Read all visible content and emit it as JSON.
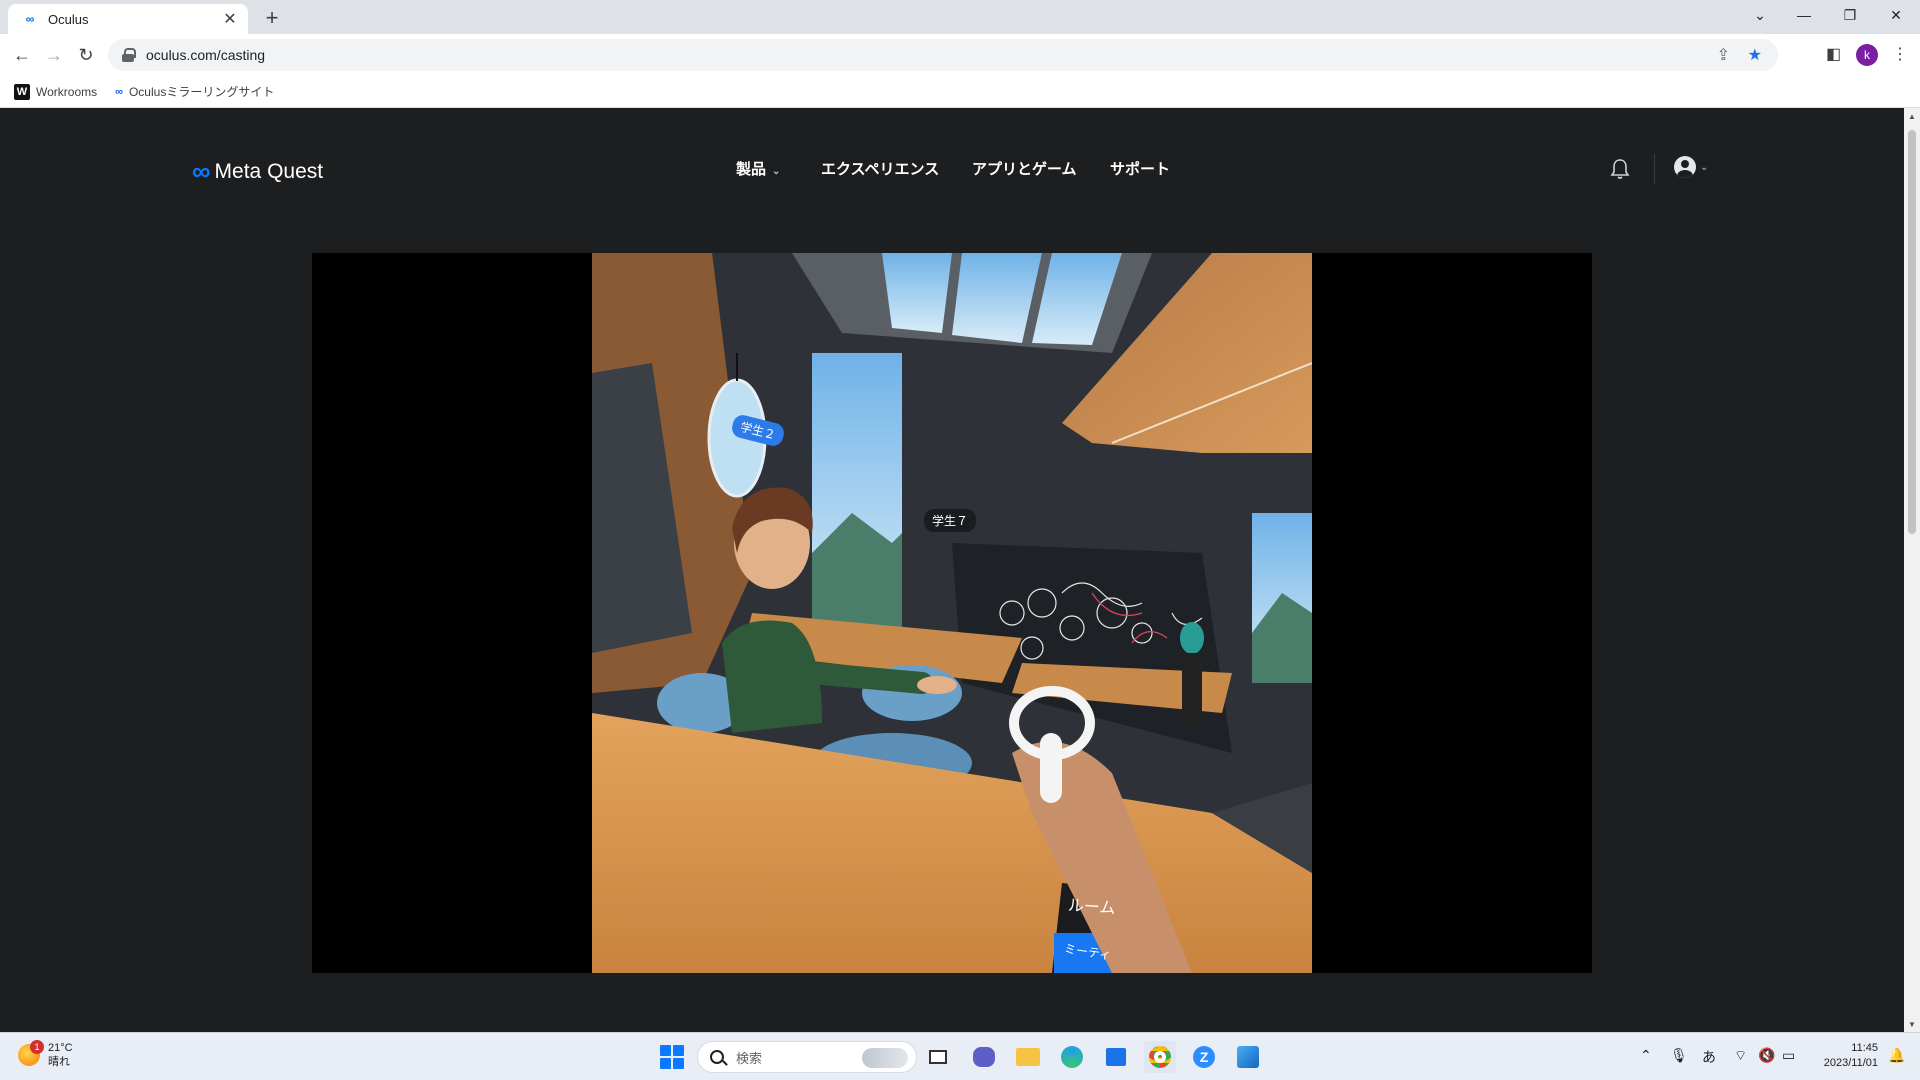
{
  "browser": {
    "tab_title": "Oculus",
    "tab_favicon": "meta-infinity-icon",
    "new_tab_label": "+",
    "url": "oculus.com/casting",
    "bookmarks": [
      {
        "label": "Workrooms",
        "icon": "workrooms-icon"
      },
      {
        "label": "Oculusミラーリングサイト",
        "icon": "meta-infinity-icon"
      }
    ],
    "profile_initial": "k"
  },
  "site": {
    "logo_text": "Meta Quest",
    "nav": {
      "products": "製品",
      "experiences": "エクスペリエンス",
      "apps_games": "アプリとゲーム",
      "support": "サポート"
    }
  },
  "video": {
    "labels": {
      "student2": "学生２",
      "student7": "学生７",
      "room": "ルーム",
      "meeting": "ミーティ"
    },
    "colors": {
      "accent": "#1877f2",
      "wood": "#d79652"
    }
  },
  "taskbar": {
    "weather_temp": "21°C",
    "weather_desc": "晴れ",
    "weather_badge": "1",
    "search_placeholder": "検索",
    "time": "11:45",
    "date": "2023/11/01",
    "ime": "あ",
    "apps": [
      "start-icon",
      "task-view-icon",
      "teams-chat-icon",
      "file-explorer-icon",
      "edge-icon",
      "store-icon",
      "chrome-icon",
      "zoom-icon",
      "paint-icon"
    ]
  },
  "colors": {
    "page_bg": "#1c1e20",
    "meta_blue": "#0a78ff",
    "chrome_tabstrip": "#dee1e6"
  }
}
